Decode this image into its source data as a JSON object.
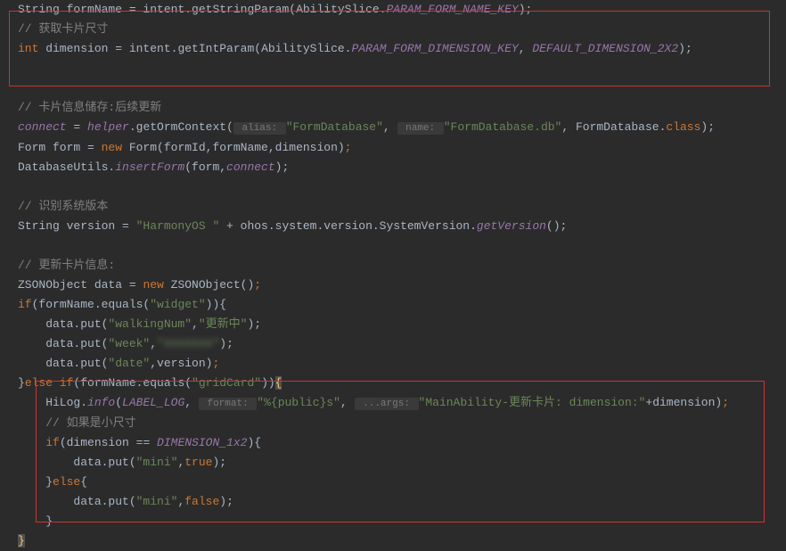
{
  "lines": {
    "l1_part1": "String formName = intent.",
    "l1_method": "getStringParam",
    "l1_part2": "(AbilitySlice.",
    "l1_const": "PARAM_FORM_NAME_KEY",
    "l1_end": ");",
    "l2_comment": "// 获取卡片尺寸",
    "l3_type": "int",
    "l3_var": " dimension = intent.",
    "l3_method": "getIntParam",
    "l3_part2": "(AbilitySlice.",
    "l3_const1": "PARAM_FORM_DIMENSION_KEY",
    "l3_comma": ", ",
    "l3_const2": "DEFAULT_DIMENSION_2X2",
    "l3_end": ");",
    "l4_comment": "// 卡片信息储存:后续更新",
    "l5_var": "connect",
    "l5_eq": " = ",
    "l5_helper": "helper",
    "l5_dot": ".",
    "l5_method": "getOrmContext",
    "l5_paren": "(",
    "l5_hint1": " alias: ",
    "l5_str1": "\"FormDatabase\"",
    "l5_c1": ", ",
    "l5_hint2": " name: ",
    "l5_str2": "\"FormDatabase.db\"",
    "l5_c2": ", FormDatabase.",
    "l5_class": "class",
    "l5_end": ");",
    "l6_part1": "Form form = ",
    "l6_new": "new",
    "l6_part2": " Form(formId,formName,dimension)",
    "l6_end": ";",
    "l7_part1": "DatabaseUtils.",
    "l7_method": "insertForm",
    "l7_part2": "(form,",
    "l7_var": "connect",
    "l7_end": ");",
    "l8_comment": "// 识别系统版本",
    "l9_part1": "String version = ",
    "l9_str": "\"HarmonyOS \"",
    "l9_part2": " + ohos.system.version.SystemVersion.",
    "l9_method": "getVersion",
    "l9_end": "();",
    "l10_comment": "// 更新卡片信息:",
    "l11_part1": "ZSONObject data = ",
    "l11_new": "new",
    "l11_part2": " ZSONObject()",
    "l11_end": ";",
    "l12_if": "if",
    "l12_part1": "(formName.equals(",
    "l12_str": "\"widget\"",
    "l12_part2": ")){",
    "l13_part1": "    data.put(",
    "l13_str1": "\"walkingNum\"",
    "l13_c": ",",
    "l13_str2": "\"更新中\"",
    "l13_end": ");",
    "l14_part1": "    data.put(",
    "l14_str1": "\"week\"",
    "l14_c": ",",
    "l14_str2": "\"XXXXXXX\"",
    "l14_end": ");",
    "l15_part1": "    data.put(",
    "l15_str1": "\"date\"",
    "l15_c": ",version)",
    "l15_end": ";",
    "l16_close": "}",
    "l16_else": "else if",
    "l16_part1": "(formName.equals(",
    "l16_str": "\"gridCard\"",
    "l16_part2": "))",
    "l16_brace": "{",
    "l17_part1": "    HiLog.",
    "l17_method": "info",
    "l17_paren": "(",
    "l17_const": "LABEL_LOG",
    "l17_c1": ", ",
    "l17_hint1": " format: ",
    "l17_str1": "\"%{public}s\"",
    "l17_c2": ", ",
    "l17_hint2": " ...args: ",
    "l17_str2": "\"MainAbility-更新卡片: dimension:\"",
    "l17_plus": "+dimension)",
    "l17_end": ";",
    "l18_comment": "    // 如果是小尺寸",
    "l19_indent": "    ",
    "l19_if": "if",
    "l19_part1": "(dimension == ",
    "l19_const": "DIMENSION_1x2",
    "l19_part2": "){",
    "l20_part1": "        data.put(",
    "l20_str": "\"mini\"",
    "l20_c": ",",
    "l20_true": "true",
    "l20_end": ");",
    "l21_close": "    }",
    "l21_else": "else",
    "l21_brace": "{",
    "l22_part1": "        data.put(",
    "l22_str": "\"mini\"",
    "l22_c": ",",
    "l22_false": "false",
    "l22_end": ");",
    "l23_close": "    }",
    "l24_close": "}"
  }
}
